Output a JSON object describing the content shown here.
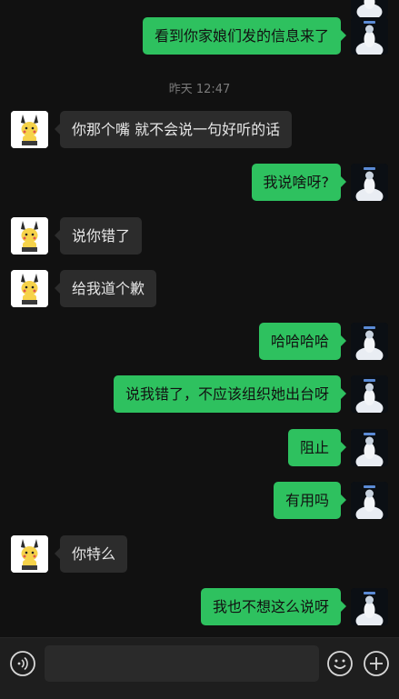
{
  "timestamp": "昨天 12:47",
  "messages": [
    {
      "side": "out",
      "text": "看到你家娘们发的信息来了"
    },
    {
      "side": "in",
      "text": "你那个嘴 就不会说一句好听的话"
    },
    {
      "side": "out",
      "text": "我说啥呀?"
    },
    {
      "side": "in",
      "text": "说你错了"
    },
    {
      "side": "in",
      "text": "给我道个歉"
    },
    {
      "side": "out",
      "text": "哈哈哈哈"
    },
    {
      "side": "out",
      "text": "说我错了，不应该组织她出台呀"
    },
    {
      "side": "out",
      "text": "阻止"
    },
    {
      "side": "out",
      "text": "有用吗"
    },
    {
      "side": "in",
      "text": "你特么"
    },
    {
      "side": "out",
      "text": "我也不想这么说呀"
    }
  ],
  "input_bar": {
    "voice_icon": "voice-icon",
    "emoji_icon": "emoji-icon",
    "plus_icon": "plus-icon",
    "text_value": ""
  },
  "colors": {
    "background": "#111111",
    "outgoing_bubble": "#2ec15f",
    "incoming_bubble": "#2c2c2c"
  }
}
